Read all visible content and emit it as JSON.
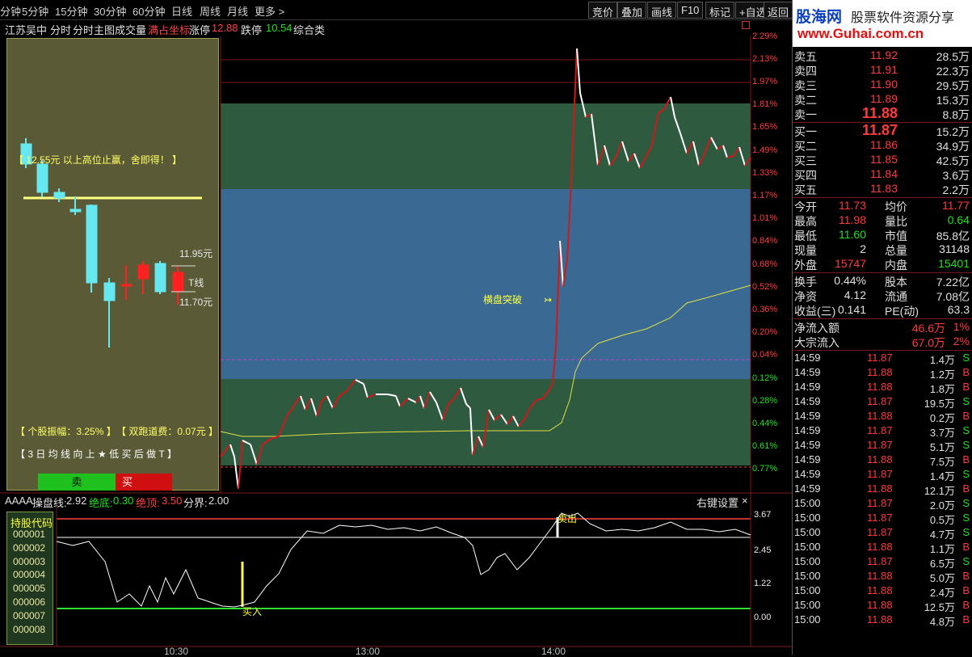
{
  "toolbar": {
    "periods": [
      "分钟",
      "5分钟",
      "15分钟",
      "30分钟",
      "60分钟",
      "日线",
      "周线",
      "月线",
      "更多 >"
    ],
    "right": [
      "竞价",
      "叠加",
      "画线",
      "F10",
      "标记",
      "+自选",
      "返回"
    ]
  },
  "banner": {
    "brand": "股海网",
    "tagline": "股票软件资源分享",
    "url": "www.Guhai.com.cn"
  },
  "info": {
    "name": "江苏吴中",
    "mode1": "分时",
    "mode2": "分时主图",
    "vol": "成交量",
    "coord": "满占坐标",
    "limit_up_label": "涨停",
    "limit_up": "12.88",
    "limit_down_label": "跌停",
    "limit_down": "10.54",
    "sector": "综合类"
  },
  "panel": {
    "note1": "【 12.55元 以上高位止赢，舍即得！ 】",
    "high_price": "11.95元",
    "t_line": "T线",
    "low_price": "11.70元",
    "amp": "【 个股振幅：3.25% 】",
    "fee": "【 双跑道费：0.07元 】",
    "tip": "【 3 日 均 线 向 上 ★ 低 买 后 做 T 】",
    "sell": "卖",
    "buy": "买"
  },
  "chart": {
    "pct_labels": [
      "2.29%",
      "2.13%",
      "1.97%",
      "1.81%",
      "1.65%",
      "1.49%",
      "1.33%",
      "1.17%",
      "1.01%",
      "0.84%",
      "0.68%",
      "0.52%",
      "0.36%",
      "0.20%",
      "0.04%",
      "0.12%",
      "0.28%",
      "0.44%",
      "0.61%",
      "0.77%"
    ],
    "annotation": "横盘突破"
  },
  "indicator": {
    "name": "AAAA",
    "line_label": "操盘线:",
    "line_val": "2.92",
    "bottom_label": "绝底:",
    "bottom_val": "0.30",
    "top_label": "绝顶:",
    "top_val": "3.50",
    "bound_label": "分界:",
    "bound_val": "2.00",
    "settings": "右键设置",
    "close": "×",
    "axis": [
      "3.67",
      "2.45",
      "1.22",
      "0.00"
    ],
    "buy_mark": "买入",
    "sell_mark": "卖出"
  },
  "holdings": {
    "title": "持股代码",
    "codes": [
      "000001",
      "000002",
      "000003",
      "000004",
      "000005",
      "000006",
      "000007",
      "000008"
    ]
  },
  "time_axis": [
    "10:30",
    "13:00",
    "14:00"
  ],
  "quote": {
    "asks": [
      [
        "卖五",
        "11.92",
        "28.5万"
      ],
      [
        "卖四",
        "11.91",
        "22.3万"
      ],
      [
        "卖三",
        "11.90",
        "29.5万"
      ],
      [
        "卖二",
        "11.89",
        "15.3万"
      ],
      [
        "卖一",
        "11.88",
        "8.8万"
      ]
    ],
    "bids": [
      [
        "买一",
        "11.87",
        "15.2万"
      ],
      [
        "买二",
        "11.86",
        "34.9万"
      ],
      [
        "买三",
        "11.85",
        "42.5万"
      ],
      [
        "买四",
        "11.84",
        "3.6万"
      ],
      [
        "买五",
        "11.83",
        "2.2万"
      ]
    ],
    "stats": [
      [
        "今开",
        "11.73",
        "均价",
        "11.77"
      ],
      [
        "最高",
        "11.98",
        "量比",
        "0.64"
      ],
      [
        "最低",
        "11.60",
        "市值",
        "85.8亿"
      ],
      [
        "现量",
        "2",
        "总量",
        "31148"
      ],
      [
        "外盘",
        "15747",
        "内盘",
        "15401"
      ]
    ],
    "stats2": [
      [
        "换手",
        "0.44%",
        "股本",
        "7.22亿"
      ],
      [
        "净资",
        "4.12",
        "流通",
        "7.08亿"
      ],
      [
        "收益(三)",
        "0.141",
        "PE(动)",
        "63.3"
      ]
    ],
    "flow": [
      [
        "净流入额",
        "46.6万",
        "1%"
      ],
      [
        "大宗流入",
        "67.0万",
        "2%"
      ]
    ],
    "ticks": [
      [
        "14:59",
        "11.87",
        "1.4万",
        "S"
      ],
      [
        "14:59",
        "11.88",
        "1.2万",
        "B"
      ],
      [
        "14:59",
        "11.88",
        "1.8万",
        "B"
      ],
      [
        "14:59",
        "11.87",
        "19.5万",
        "S"
      ],
      [
        "14:59",
        "11.88",
        "0.2万",
        "B"
      ],
      [
        "14:59",
        "11.87",
        "3.7万",
        "S"
      ],
      [
        "14:59",
        "11.87",
        "5.1万",
        "S"
      ],
      [
        "14:59",
        "11.88",
        "7.5万",
        "B"
      ],
      [
        "14:59",
        "11.87",
        "1.4万",
        "S"
      ],
      [
        "14:59",
        "11.88",
        "12.1万",
        "B"
      ],
      [
        "15:00",
        "11.87",
        "2.0万",
        "S"
      ],
      [
        "15:00",
        "11.87",
        "0.5万",
        "S"
      ],
      [
        "15:00",
        "11.87",
        "4.7万",
        "S"
      ],
      [
        "15:00",
        "11.88",
        "1.1万",
        "B"
      ],
      [
        "15:00",
        "11.87",
        "6.5万",
        "S"
      ],
      [
        "15:00",
        "11.88",
        "5.0万",
        "B"
      ],
      [
        "15:00",
        "11.88",
        "2.4万",
        "B"
      ],
      [
        "15:00",
        "11.88",
        "12.5万",
        "B"
      ],
      [
        "15:00",
        "11.88",
        "4.8万",
        "B"
      ]
    ]
  }
}
